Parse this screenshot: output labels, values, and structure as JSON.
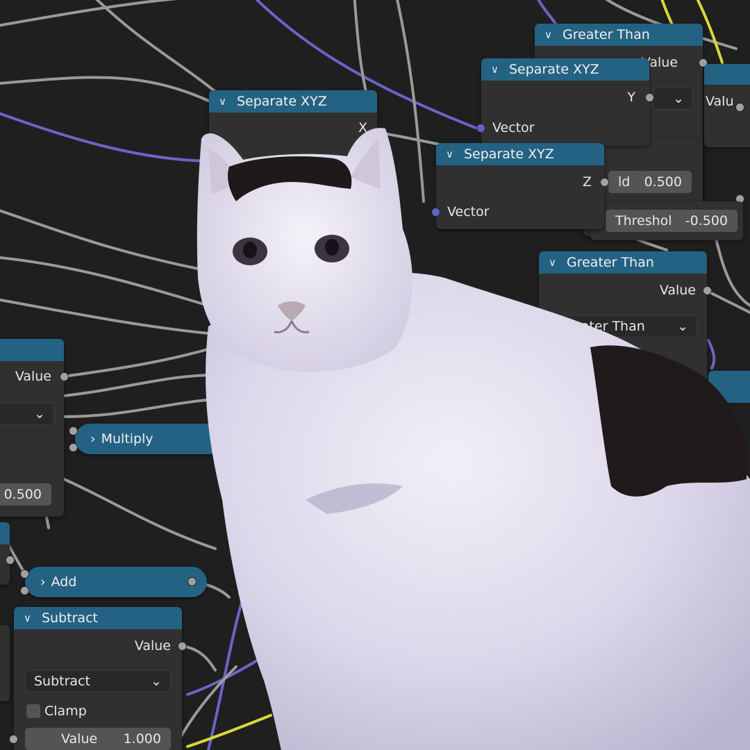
{
  "colors": {
    "background": "#1f1f1f",
    "node_body": "#303030",
    "node_header": "#246283",
    "vector_socket": "#6363c7",
    "value_socket": "#a1a1a1"
  },
  "nodes": {
    "greater_than_top": {
      "title": "Greater Than",
      "output": "Value"
    },
    "separate_xyz_top_right": {
      "title": "Separate XYZ",
      "output": "Y",
      "input": "Vector"
    },
    "separate_xyz_center": {
      "title": "Separate XYZ",
      "output": "X"
    },
    "separate_xyz_mid": {
      "title": "Separate XYZ",
      "output": "Z",
      "input": "Vector"
    },
    "partial_right": {
      "output": "Value",
      "threshold_partial": "ld",
      "threshold_value": "0.500"
    },
    "threshold_field": {
      "label": "Threshol",
      "value": "-0.500"
    },
    "greater_than_right": {
      "title": "Greater Than",
      "output": "Value",
      "operation": "Greater Than"
    },
    "left_partial": {
      "output": "Value",
      "field_value": "0.500"
    },
    "multiply": {
      "title": "Multiply"
    },
    "add": {
      "title": "Add"
    },
    "subtract": {
      "title": "Subtract",
      "output": "Value",
      "operation": "Subtract",
      "clamp_label": "Clamp",
      "value_label": "Value",
      "value": "1.000"
    }
  }
}
